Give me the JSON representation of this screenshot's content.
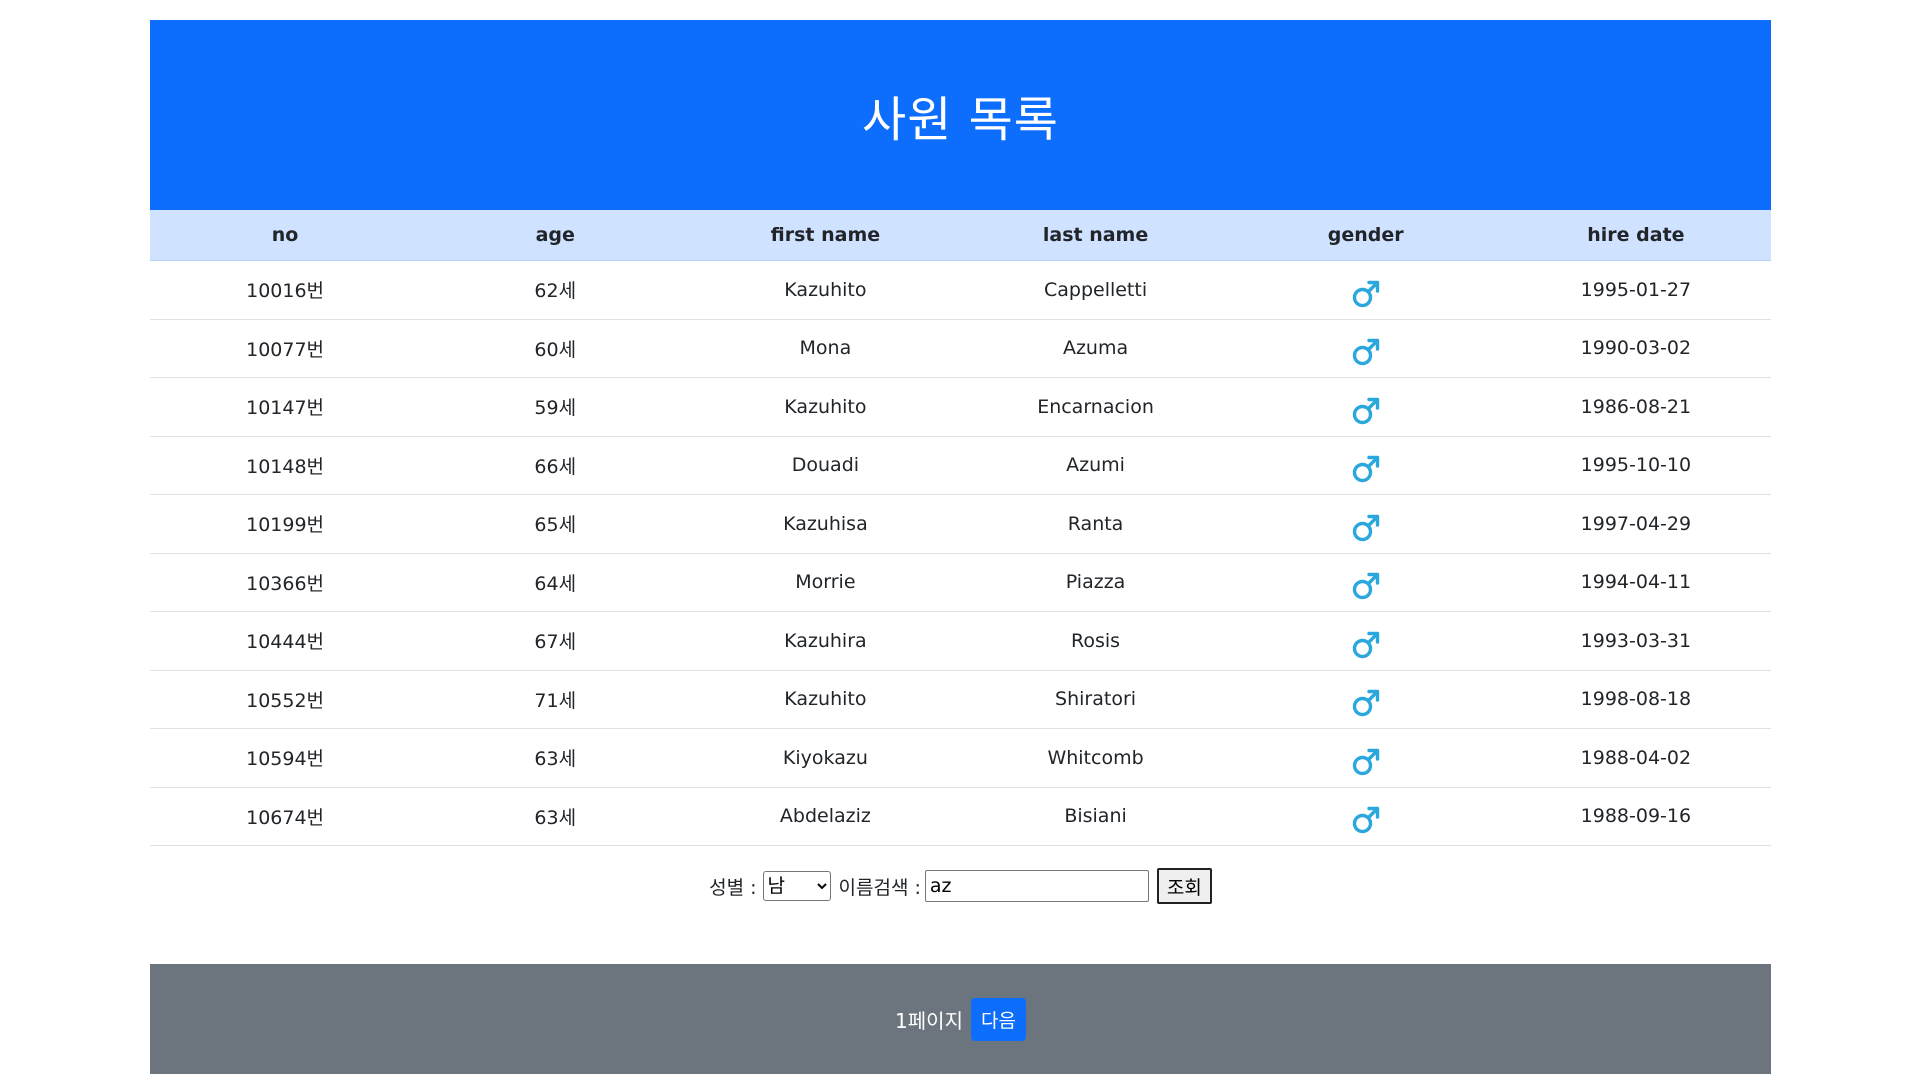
{
  "page": {
    "title": "사원 목록"
  },
  "table": {
    "headers": [
      "no",
      "age",
      "first name",
      "last name",
      "gender",
      "hire date"
    ],
    "gender_icon": "male-symbol-icon",
    "rows": [
      {
        "no": "10016번",
        "age": "62세",
        "first_name": "Kazuhito",
        "last_name": "Cappelletti",
        "gender": "M",
        "hire_date": "1995-01-27"
      },
      {
        "no": "10077번",
        "age": "60세",
        "first_name": "Mona",
        "last_name": "Azuma",
        "gender": "M",
        "hire_date": "1990-03-02"
      },
      {
        "no": "10147번",
        "age": "59세",
        "first_name": "Kazuhito",
        "last_name": "Encarnacion",
        "gender": "M",
        "hire_date": "1986-08-21"
      },
      {
        "no": "10148번",
        "age": "66세",
        "first_name": "Douadi",
        "last_name": "Azumi",
        "gender": "M",
        "hire_date": "1995-10-10"
      },
      {
        "no": "10199번",
        "age": "65세",
        "first_name": "Kazuhisa",
        "last_name": "Ranta",
        "gender": "M",
        "hire_date": "1997-04-29"
      },
      {
        "no": "10366번",
        "age": "64세",
        "first_name": "Morrie",
        "last_name": "Piazza",
        "gender": "M",
        "hire_date": "1994-04-11"
      },
      {
        "no": "10444번",
        "age": "67세",
        "first_name": "Kazuhira",
        "last_name": "Rosis",
        "gender": "M",
        "hire_date": "1993-03-31"
      },
      {
        "no": "10552번",
        "age": "71세",
        "first_name": "Kazuhito",
        "last_name": "Shiratori",
        "gender": "M",
        "hire_date": "1998-08-18"
      },
      {
        "no": "10594번",
        "age": "63세",
        "first_name": "Kiyokazu",
        "last_name": "Whitcomb",
        "gender": "M",
        "hire_date": "1988-04-02"
      },
      {
        "no": "10674번",
        "age": "63세",
        "first_name": "Abdelaziz",
        "last_name": "Bisiani",
        "gender": "M",
        "hire_date": "1988-09-16"
      }
    ]
  },
  "search": {
    "gender_label": "성별 :",
    "gender_selected": "남",
    "name_label": "이름검색 :",
    "name_value": "az",
    "submit_label": "조회"
  },
  "footer": {
    "page_text": "1페이지",
    "next_label": "다음"
  },
  "colors": {
    "header_bg": "#0d6efd",
    "thead_bg": "#cfe2ff",
    "footer_bg": "#6c757d",
    "male_icon": "#2aa7dc"
  }
}
